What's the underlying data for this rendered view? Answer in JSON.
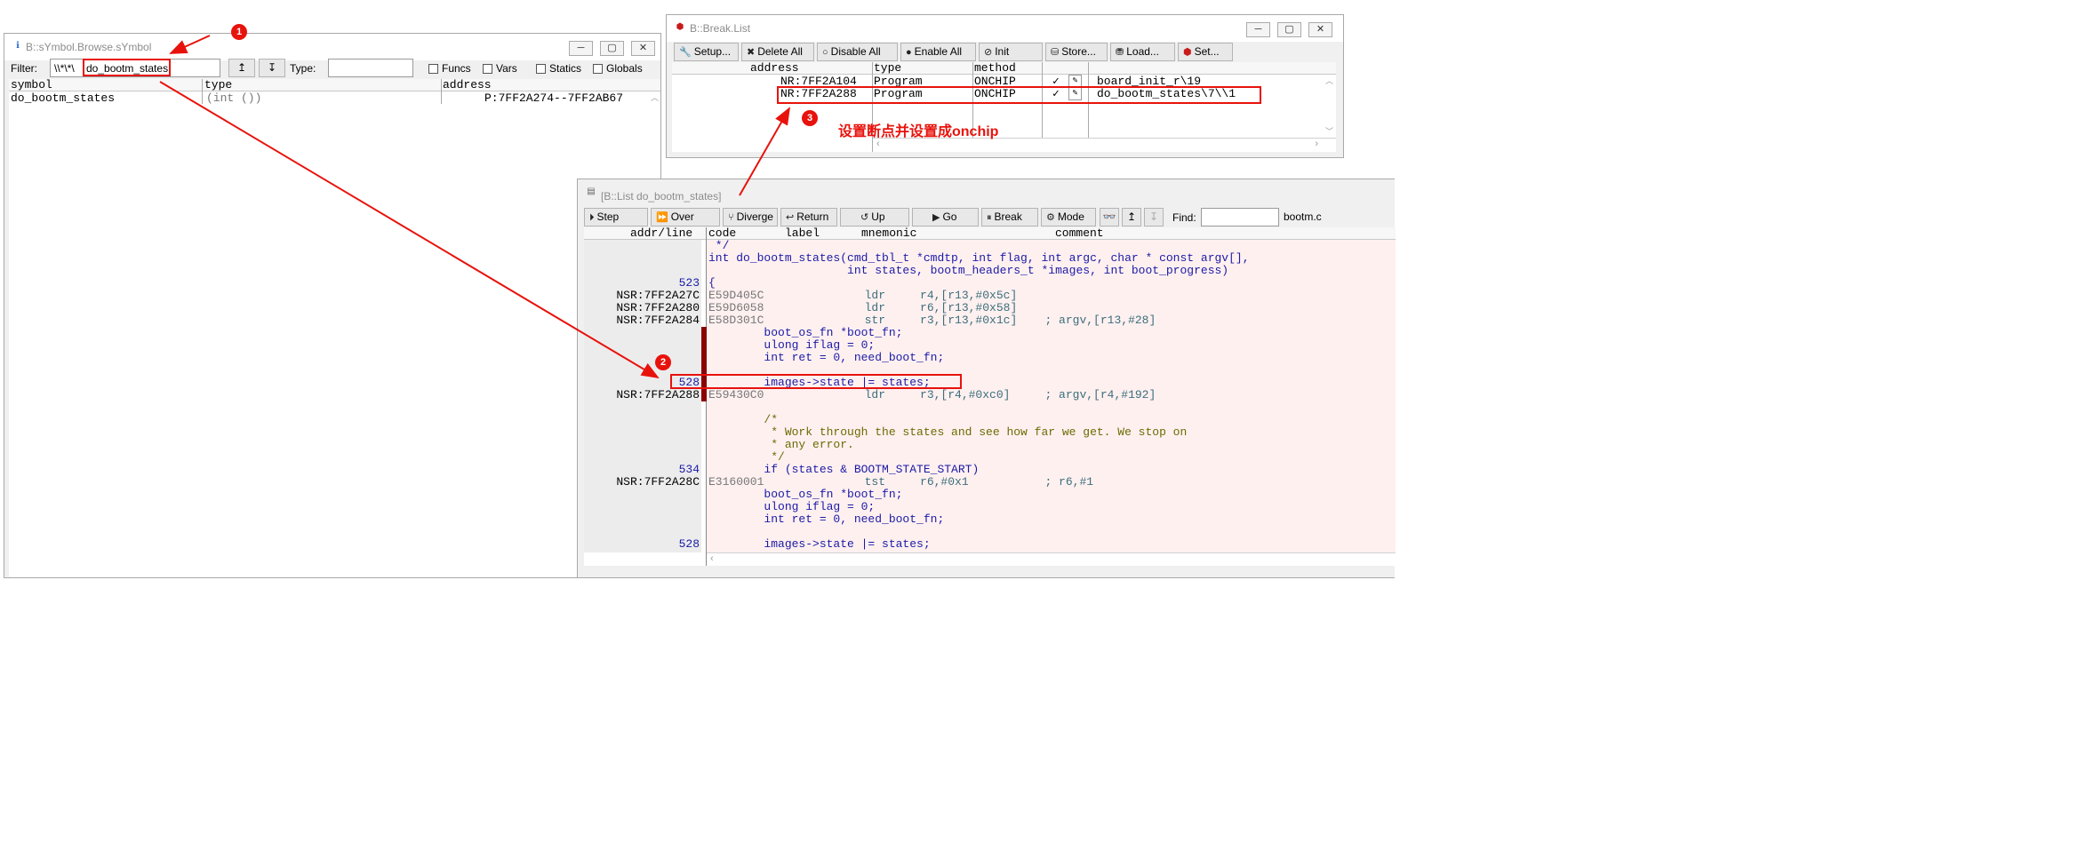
{
  "symbol_window": {
    "title": "B::sYmbol.Browse.sYmbol",
    "filter_label": "Filter:",
    "filter_prefix": "\\\\*\\*\\",
    "filter_value": "do_bootm_states",
    "type_label": "Type:",
    "checkboxes": [
      "Funcs",
      "Vars",
      "Statics",
      "Globals"
    ],
    "columns": [
      "symbol",
      "type",
      "address"
    ],
    "rows": [
      {
        "symbol": "do_bootm_states",
        "type": "(int ())",
        "address": "P:7FF2A274--7FF2AB67"
      }
    ]
  },
  "break_window": {
    "title": "B::Break.List",
    "toolbar": [
      "Setup...",
      "Delete All",
      "Disable All",
      "Enable All",
      "Init",
      "Store...",
      "Load...",
      "Set..."
    ],
    "columns": [
      "address",
      "type",
      "method"
    ],
    "rows": [
      {
        "address": "NR:7FF2A104",
        "type": "Program",
        "method": "ONCHIP",
        "check": "✓",
        "location": "board_init_r\\19"
      },
      {
        "address": "NR:7FF2A288",
        "type": "Program",
        "method": "ONCHIP",
        "check": "✓",
        "location": "do_bootm_states\\7\\\\1"
      }
    ]
  },
  "list_window": {
    "title": "[B::List do_bootm_states]",
    "toolbar": [
      "Step",
      "Over",
      "Diverge",
      "Return",
      "Up",
      "Go",
      "Break",
      "Mode"
    ],
    "find_label": "Find:",
    "file": "bootm.c",
    "columns": [
      "addr/line",
      "code",
      "label",
      "mnemonic",
      "comment"
    ],
    "lines": [
      {
        "addr": "",
        "code": "",
        "text": " */",
        "kind": "src"
      },
      {
        "addr": "",
        "code": "",
        "text": "int do_bootm_states(cmd_tbl_t *cmdtp, int flag, int argc, char * const argv[],",
        "kind": "src"
      },
      {
        "addr": "",
        "code": "",
        "text": "                    int states, bootm_headers_t *images, int boot_progress)",
        "kind": "src"
      },
      {
        "addr": "523",
        "code": "",
        "text": "{",
        "kind": "src"
      },
      {
        "addr": "NSR:7FF2A27C",
        "code": "E59D405C",
        "text": "            ldr     r4,[r13,#0x5c]",
        "kind": "asm"
      },
      {
        "addr": "NSR:7FF2A280",
        "code": "E59D6058",
        "text": "            ldr     r6,[r13,#0x58]",
        "kind": "asm"
      },
      {
        "addr": "NSR:7FF2A284",
        "code": "E58D301C",
        "text": "            str     r3,[r13,#0x1c]    ; argv,[r13,#28]",
        "kind": "asm"
      },
      {
        "addr": "",
        "code": "",
        "text": "        boot_os_fn *boot_fn;",
        "kind": "src"
      },
      {
        "addr": "",
        "code": "",
        "text": "        ulong iflag = 0;",
        "kind": "src"
      },
      {
        "addr": "",
        "code": "",
        "text": "        int ret = 0, need_boot_fn;",
        "kind": "src"
      },
      {
        "addr": "",
        "code": "",
        "text": "",
        "kind": "src"
      },
      {
        "addr": "528",
        "code": "",
        "text": "        images->state |= states;",
        "kind": "src"
      },
      {
        "addr": "NSR:7FF2A288",
        "code": "E59430C0",
        "text": "            ldr     r3,[r4,#0xc0]     ; argv,[r4,#192]",
        "kind": "asm"
      },
      {
        "addr": "",
        "code": "",
        "text": "",
        "kind": "src"
      },
      {
        "addr": "",
        "code": "",
        "text": "        /*",
        "kind": "cmt"
      },
      {
        "addr": "",
        "code": "",
        "text": "         * Work through the states and see how far we get. We stop on",
        "kind": "cmt"
      },
      {
        "addr": "",
        "code": "",
        "text": "         * any error.",
        "kind": "cmt"
      },
      {
        "addr": "",
        "code": "",
        "text": "         */",
        "kind": "cmt"
      },
      {
        "addr": "534",
        "code": "",
        "text": "        if (states & BOOTM_STATE_START)",
        "kind": "src"
      },
      {
        "addr": "NSR:7FF2A28C",
        "code": "E3160001",
        "text": "            tst     r6,#0x1           ; r6,#1",
        "kind": "asm"
      },
      {
        "addr": "",
        "code": "",
        "text": "        boot_os_fn *boot_fn;",
        "kind": "src"
      },
      {
        "addr": "",
        "code": "",
        "text": "        ulong iflag = 0;",
        "kind": "src"
      },
      {
        "addr": "",
        "code": "",
        "text": "        int ret = 0, need_boot_fn;",
        "kind": "src"
      },
      {
        "addr": "",
        "code": "",
        "text": "",
        "kind": "src"
      },
      {
        "addr": "528",
        "code": "",
        "text": "        images->state |= states;",
        "kind": "src"
      }
    ]
  },
  "annotations": {
    "markers": [
      "1",
      "2",
      "3"
    ],
    "note": "设置断点并设置成onchip"
  },
  "colors": {
    "accent_red": "#e8120c",
    "code_bg": "#fff0f0",
    "breakpoint_bar": "#8b0000",
    "line_number_blue": "#1a1aa6"
  }
}
